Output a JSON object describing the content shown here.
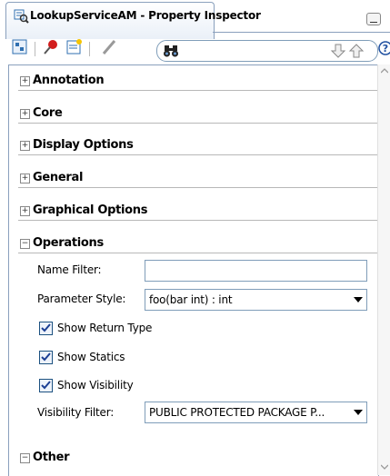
{
  "window": {
    "title": "LookupServiceAM - Property Inspector"
  },
  "toolbar": {
    "search_placeholder": ""
  },
  "sections": [
    {
      "label": "Annotation",
      "expanded": false
    },
    {
      "label": "Core",
      "expanded": false
    },
    {
      "label": "Display Options",
      "expanded": false
    },
    {
      "label": "General",
      "expanded": false
    },
    {
      "label": "Graphical Options",
      "expanded": false
    },
    {
      "label": "Operations",
      "expanded": true
    },
    {
      "label": "Other",
      "expanded": false
    }
  ],
  "operations": {
    "name_filter_label": "Name Filter:",
    "name_filter_value": "",
    "parameter_style_label": "Parameter Style:",
    "parameter_style_value": "foo(bar int) : int",
    "show_return_type_label": "Show Return Type",
    "show_return_type_checked": true,
    "show_statics_label": "Show Statics",
    "show_statics_checked": true,
    "show_visibility_label": "Show Visibility",
    "show_visibility_checked": true,
    "visibility_filter_label": "Visibility Filter:",
    "visibility_filter_value": "PUBLIC PROTECTED PACKAGE P..."
  },
  "icons": {
    "expand": "plus-box-icon",
    "collapse": "minus-box-icon"
  }
}
